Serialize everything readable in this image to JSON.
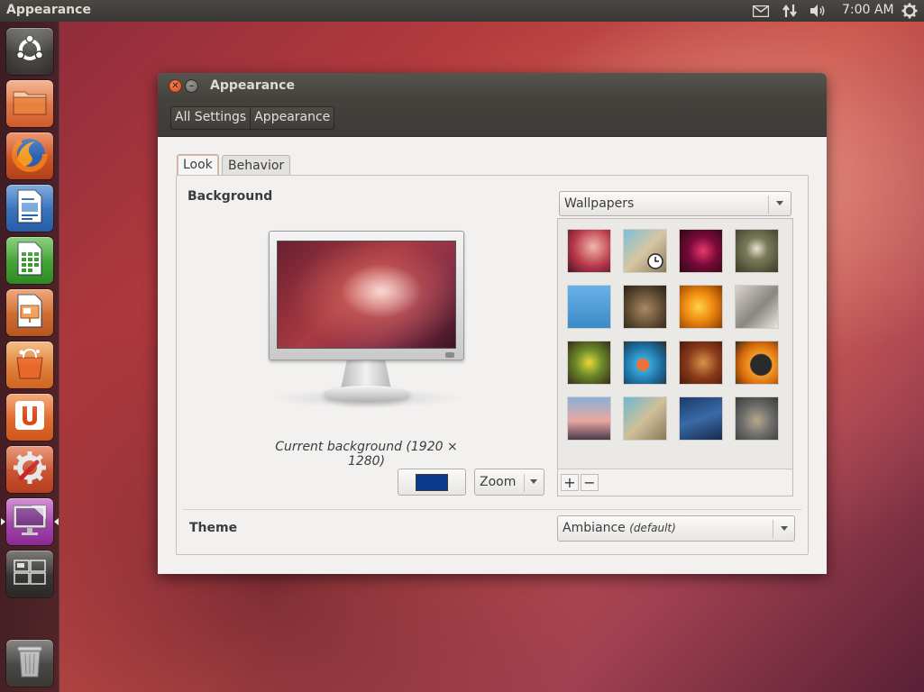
{
  "panel": {
    "app_title": "Appearance",
    "clock": "7:00 AM",
    "indicators": [
      "mail-icon",
      "network-icon",
      "volume-icon",
      "gear-icon"
    ]
  },
  "launcher": {
    "items": [
      {
        "name": "dash-home",
        "icon": "ubuntu-logo-icon"
      },
      {
        "name": "home-folder",
        "icon": "folder-icon"
      },
      {
        "name": "firefox",
        "icon": "firefox-icon"
      },
      {
        "name": "writer",
        "icon": "libreoffice-writer-icon"
      },
      {
        "name": "calc",
        "icon": "libreoffice-calc-icon"
      },
      {
        "name": "impress",
        "icon": "libreoffice-impress-icon"
      },
      {
        "name": "software-center",
        "icon": "shopping-bag-icon"
      },
      {
        "name": "ubuntu-one",
        "icon": "ubuntu-one-icon"
      },
      {
        "name": "system-settings",
        "icon": "settings-wrench-icon"
      },
      {
        "name": "appearance",
        "icon": "appearance-monitor-icon"
      },
      {
        "name": "workspace-switcher",
        "icon": "workspaces-icon"
      },
      {
        "name": "trash",
        "icon": "trash-icon"
      }
    ]
  },
  "window": {
    "title": "Appearance",
    "breadcrumbs": [
      "All Settings",
      "Appearance"
    ],
    "tabs": [
      {
        "label": "Look",
        "active": true
      },
      {
        "label": "Behavior",
        "active": false
      }
    ],
    "background": {
      "label": "Background",
      "caption": "Current background (1920 × 1280)",
      "color": "#0b3a8a",
      "mode_select": "Zoom",
      "source_select": "Wallpapers"
    },
    "theme": {
      "label": "Theme",
      "value": "Ambiance",
      "value_note": "(default)"
    },
    "grid_buttons": {
      "add": "+",
      "remove": "−"
    }
  },
  "colors": {
    "panel_bg": "#3c3b37",
    "accent": "#dd4814",
    "window_bg": "#f2f1f0"
  }
}
